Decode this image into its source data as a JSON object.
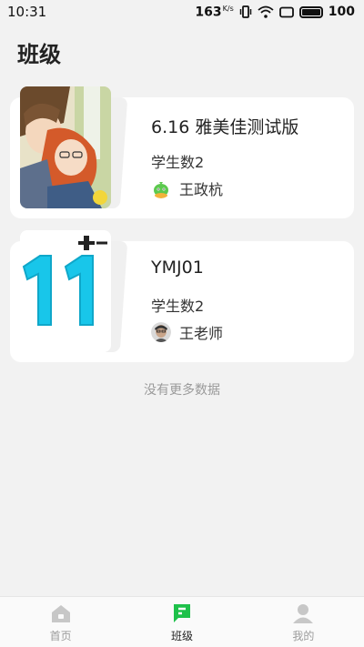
{
  "status_bar": {
    "time": "10:31",
    "net_speed": "163",
    "net_unit": "K/s",
    "battery": "100"
  },
  "page": {
    "title": "班级"
  },
  "classes": [
    {
      "name": "6.16 雅美佳测试版",
      "count_label": "学生数2",
      "teacher": "王政杭",
      "cover": "anime-illustration"
    },
    {
      "name": "YMJ01",
      "count_label": "学生数2",
      "teacher": "王老师",
      "cover": "number-11-graphic"
    }
  ],
  "no_more_text": "没有更多数据",
  "tabs": [
    {
      "label": "首页",
      "icon": "home-icon"
    },
    {
      "label": "班级",
      "icon": "class-icon"
    },
    {
      "label": "我的",
      "icon": "profile-icon"
    }
  ],
  "colors": {
    "accent": "#1ec14a",
    "cyan": "#18c6ea"
  }
}
